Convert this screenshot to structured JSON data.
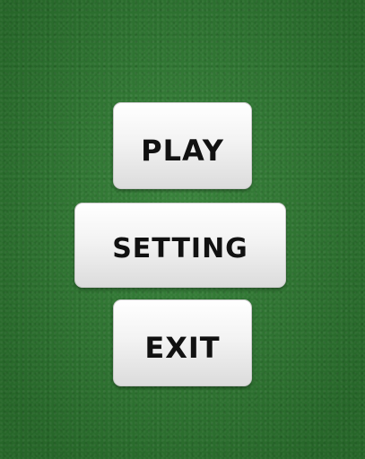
{
  "background": {
    "color": "#2f7d32",
    "texture": "green-felt"
  },
  "menu": {
    "buttons": [
      {
        "label": "Play"
      },
      {
        "label": "Setting"
      },
      {
        "label": "Exit"
      }
    ]
  }
}
